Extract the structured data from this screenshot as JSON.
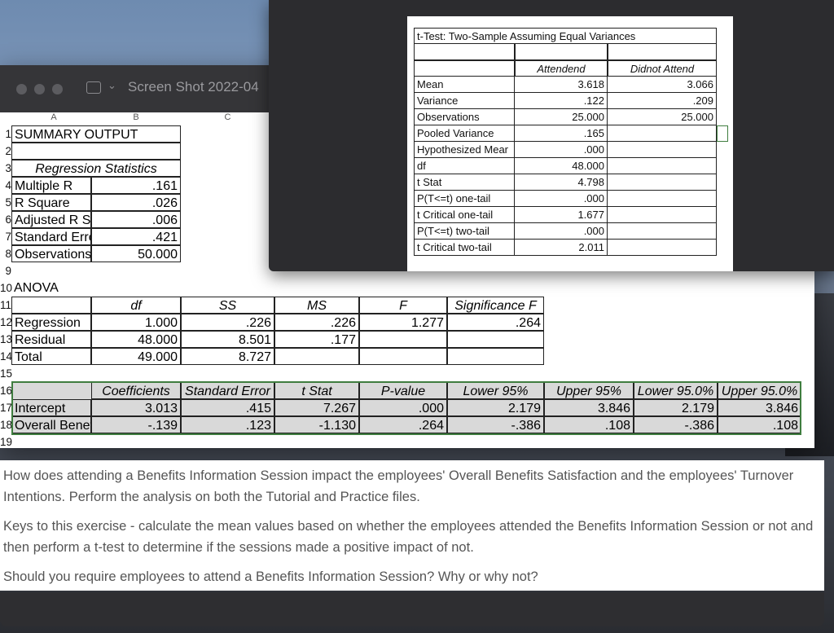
{
  "back_window": {
    "title": "Screen Shot 2022-04",
    "col_headers": [
      "A",
      "B",
      "C"
    ],
    "row_numbers": [
      "1",
      "2",
      "3",
      "4",
      "5",
      "6",
      "7",
      "8",
      "9",
      "10",
      "11",
      "12",
      "13",
      "14",
      "15",
      "16",
      "17",
      "18",
      "19"
    ],
    "summary_title": "SUMMARY OUTPUT",
    "regression_stats_header": "Regression Statistics",
    "regression_stats": [
      {
        "label": "Multiple R",
        "value": ".161"
      },
      {
        "label": "R Square",
        "value": ".026"
      },
      {
        "label": "Adjusted R Squ",
        "value": ".006"
      },
      {
        "label": "Standard Error",
        "value": ".421"
      },
      {
        "label": "Observations",
        "value": "50.000"
      }
    ],
    "anova_title": "ANOVA",
    "anova_headers": [
      "df",
      "SS",
      "MS",
      "F",
      "Significance F"
    ],
    "anova_rows": [
      {
        "label": "Regression",
        "df": "1.000",
        "ss": ".226",
        "ms": ".226",
        "f": "1.277",
        "sig": ".264"
      },
      {
        "label": "Residual",
        "df": "48.000",
        "ss": "8.501",
        "ms": ".177",
        "f": "",
        "sig": ""
      },
      {
        "label": "Total",
        "df": "49.000",
        "ss": "8.727",
        "ms": "",
        "f": "",
        "sig": ""
      }
    ],
    "coef_headers": [
      "Coefficients",
      "Standard Error",
      "t Stat",
      "P-value",
      "Lower 95%",
      "Upper 95%",
      "Lower 95.0%",
      "Upper 95.0%"
    ],
    "coef_rows": [
      {
        "label": "Intercept",
        "values": [
          "3.013",
          ".415",
          "7.267",
          ".000",
          "2.179",
          "3.846",
          "2.179",
          "3.846"
        ]
      },
      {
        "label": "Overall Benefit",
        "values": [
          "-.139",
          ".123",
          "-1.130",
          ".264",
          "-.386",
          ".108",
          "-.386",
          ".108"
        ]
      }
    ]
  },
  "ttest": {
    "title": "t-Test: Two-Sample Assuming Equal Variances",
    "headers": [
      "Attendend",
      "Didnot Attend"
    ],
    "rows": [
      {
        "label": "Mean",
        "a": "3.618",
        "b": "3.066"
      },
      {
        "label": "Variance",
        "a": ".122",
        "b": ".209"
      },
      {
        "label": "Observations",
        "a": "25.000",
        "b": "25.000"
      },
      {
        "label": "Pooled Variance",
        "a": ".165",
        "b": ""
      },
      {
        "label": "Hypothesized Mear",
        "a": ".000",
        "b": ""
      },
      {
        "label": "df",
        "a": "48.000",
        "b": ""
      },
      {
        "label": "t Stat",
        "a": "4.798",
        "b": ""
      },
      {
        "label": "P(T<=t) one-tail",
        "a": ".000",
        "b": ""
      },
      {
        "label": "t Critical one-tail",
        "a": "1.677",
        "b": ""
      },
      {
        "label": "P(T<=t) two-tail",
        "a": ".000",
        "b": ""
      },
      {
        "label": "t Critical two-tail",
        "a": "2.011",
        "b": ""
      }
    ]
  },
  "question": {
    "p1": "How does attending a Benefits Information Session impact the employees' Overall Benefits Satisfaction and the employees' Turnover Intentions. Perform the analysis on both the Tutorial and Practice files.",
    "p2": "Keys to this exercise - calculate the mean values based on whether the employees attended the Benefits Information Session or not and then perform a t-test to determine if the sessions made a positive impact of not.",
    "p3": "Should you require employees to attend a Benefits Information Session? Why or why not?"
  }
}
